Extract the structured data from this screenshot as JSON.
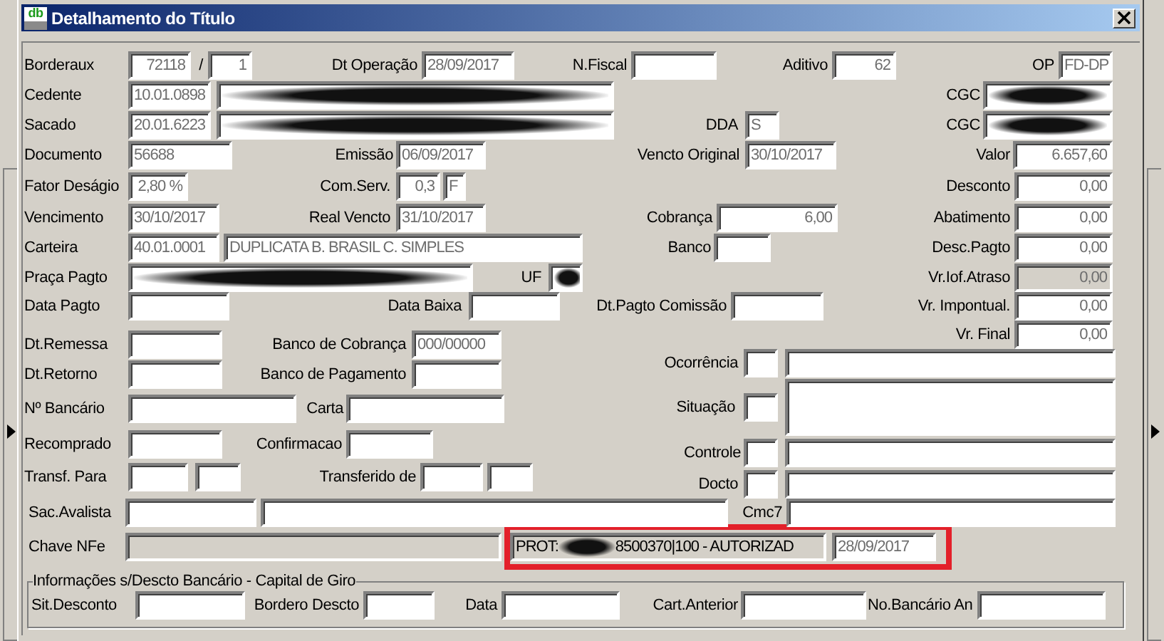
{
  "window": {
    "title": "Detalhamento do Título",
    "icon_text": "db"
  },
  "top_rows": [
    [
      {
        "kind": "label",
        "text": "Borderaux"
      },
      {
        "kind": "field",
        "value": "72118"
      },
      {
        "kind": "label",
        "text": "/"
      },
      {
        "kind": "field",
        "value": "1"
      },
      {
        "kind": "label",
        "text": "Dt Operação"
      },
      {
        "kind": "field",
        "value": "28/09/2017"
      },
      {
        "kind": "label",
        "text": "N.Fiscal"
      },
      {
        "kind": "field"
      },
      {
        "kind": "label",
        "text": "Aditivo"
      },
      {
        "kind": "field",
        "value": "62"
      },
      {
        "kind": "label",
        "text": "OP"
      },
      {
        "kind": "field",
        "value": "FD-DP"
      }
    ],
    [
      {
        "kind": "label",
        "text": "Cedente"
      },
      {
        "kind": "field",
        "value": "10.01.0898"
      },
      {
        "kind": "field",
        "redacted": true
      },
      {
        "kind": "label",
        "text": "CGC"
      },
      {
        "kind": "field",
        "redacted": true
      }
    ],
    [
      {
        "kind": "label",
        "text": "Sacado"
      },
      {
        "kind": "field",
        "value": "20.01.6223"
      },
      {
        "kind": "field",
        "redacted": true
      },
      {
        "kind": "label",
        "text": "DDA"
      },
      {
        "kind": "field",
        "value": "S"
      },
      {
        "kind": "label",
        "text": "CGC"
      },
      {
        "kind": "field",
        "redacted": true
      }
    ],
    [
      {
        "kind": "label",
        "text": "Documento"
      },
      {
        "kind": "field",
        "value": "56688"
      },
      {
        "kind": "label",
        "text": "Emissão"
      },
      {
        "kind": "field",
        "value": "06/09/2017"
      },
      {
        "kind": "label",
        "text": "Vencto Original"
      },
      {
        "kind": "field",
        "value": "30/10/2017"
      },
      {
        "kind": "label",
        "text": "Valor"
      },
      {
        "kind": "field",
        "value": "6.657,60"
      }
    ],
    [
      {
        "kind": "label",
        "text": "Fator Deságio"
      },
      {
        "kind": "field",
        "value": "2,80 %"
      },
      {
        "kind": "label",
        "text": "Com.Serv."
      },
      {
        "kind": "field",
        "value": "0,3"
      },
      {
        "kind": "field",
        "value": "F"
      },
      {
        "kind": "label",
        "text": "Desconto"
      },
      {
        "kind": "field",
        "value": "0,00"
      }
    ],
    [
      {
        "kind": "label",
        "text": "Vencimento"
      },
      {
        "kind": "field",
        "value": "30/10/2017"
      },
      {
        "kind": "label",
        "text": "Real Vencto"
      },
      {
        "kind": "field",
        "value": "31/10/2017"
      },
      {
        "kind": "label",
        "text": "Cobrança"
      },
      {
        "kind": "field",
        "value": "6,00"
      },
      {
        "kind": "label",
        "text": "Abatimento"
      },
      {
        "kind": "field",
        "value": "0,00"
      }
    ],
    [
      {
        "kind": "label",
        "text": "Carteira"
      },
      {
        "kind": "field",
        "value": "40.01.0001"
      },
      {
        "kind": "field",
        "value": "DUPLICATA B. BRASIL C. SIMPLES"
      },
      {
        "kind": "label",
        "text": "Banco"
      },
      {
        "kind": "field"
      },
      {
        "kind": "label",
        "text": "Desc.Pagto"
      },
      {
        "kind": "field",
        "value": "0,00"
      }
    ],
    [
      {
        "kind": "label",
        "text": "Praça Pagto"
      },
      {
        "kind": "field",
        "redacted": true
      },
      {
        "kind": "label",
        "text": "UF"
      },
      {
        "kind": "field",
        "redacted": true
      },
      {
        "kind": "label",
        "text": "Vr.Iof.Atraso"
      },
      {
        "kind": "field",
        "value": "0,00",
        "disabled": true
      }
    ],
    [
      {
        "kind": "label",
        "text": "Data Pagto"
      },
      {
        "kind": "field"
      },
      {
        "kind": "label",
        "text": "Data Baixa"
      },
      {
        "kind": "field"
      },
      {
        "kind": "label",
        "text": "Dt.Pagto Comissão"
      },
      {
        "kind": "field"
      },
      {
        "kind": "label",
        "text": "Vr. Impontual."
      },
      {
        "kind": "field",
        "value": "0,00"
      }
    ]
  ],
  "left_rows": [
    [
      {
        "kind": "label",
        "text": "Dt.Remessa"
      },
      {
        "kind": "field"
      },
      {
        "kind": "label",
        "text": "Banco de Cobrança"
      },
      {
        "kind": "field",
        "value": "000/00000"
      }
    ],
    [
      {
        "kind": "label",
        "text": "Dt.Retorno"
      },
      {
        "kind": "field"
      },
      {
        "kind": "label",
        "text": "Banco de Pagamento"
      },
      {
        "kind": "field"
      }
    ],
    [
      {
        "kind": "label",
        "text": "Nº Bancário"
      },
      {
        "kind": "field"
      },
      {
        "kind": "label",
        "text": "Carta"
      },
      {
        "kind": "field"
      }
    ],
    [
      {
        "kind": "label",
        "text": "Recomprado"
      },
      {
        "kind": "field"
      },
      {
        "kind": "label",
        "text": "Confirmacao"
      },
      {
        "kind": "field"
      }
    ],
    [
      {
        "kind": "label",
        "text": "Transf. Para"
      },
      {
        "kind": "field"
      },
      {
        "kind": "field"
      },
      {
        "kind": "label",
        "text": "Transferido de"
      },
      {
        "kind": "field"
      },
      {
        "kind": "field"
      }
    ]
  ],
  "right_rows": [
    [
      {
        "kind": "label",
        "text": "Vr. Final"
      },
      {
        "kind": "field",
        "value": "0,00"
      }
    ],
    [
      {
        "kind": "label",
        "text": "Ocorrência"
      },
      {
        "kind": "field"
      },
      {
        "kind": "field"
      }
    ],
    [
      {
        "kind": "label",
        "text": "Situação"
      },
      {
        "kind": "field"
      },
      {
        "kind": "memo"
      }
    ],
    [
      {
        "kind": "label",
        "text": "Controle"
      },
      {
        "kind": "field"
      },
      {
        "kind": "field"
      }
    ],
    [
      {
        "kind": "label",
        "text": "Docto"
      },
      {
        "kind": "field"
      },
      {
        "kind": "field"
      }
    ]
  ],
  "bottom_rows": [
    [
      {
        "kind": "label",
        "text": "Sac.Avalista"
      },
      {
        "kind": "field"
      },
      {
        "kind": "field"
      },
      {
        "kind": "label",
        "text": "Cmc7"
      },
      {
        "kind": "field"
      }
    ],
    [
      {
        "kind": "label",
        "text": "Chave NFe"
      },
      {
        "kind": "field",
        "disabled": true
      },
      {
        "kind": "highlight",
        "items": [
          {
            "kind": "prot",
            "value": "PROT:",
            "value_after": "8500370|100 - AUTORIZAD",
            "redacted": true
          },
          {
            "kind": "field",
            "value": "28/09/2017"
          }
        ]
      }
    ]
  ],
  "group": {
    "title": "Informações s/Descto Bancário - Capital de Giro",
    "items": [
      {
        "kind": "label",
        "text": "Sit.Desconto"
      },
      {
        "kind": "field"
      },
      {
        "kind": "label",
        "text": "Bordero Descto"
      },
      {
        "kind": "field"
      },
      {
        "kind": "label",
        "text": "Data"
      },
      {
        "kind": "field"
      },
      {
        "kind": "label",
        "text": "Cart.Anterior"
      },
      {
        "kind": "field"
      },
      {
        "kind": "label",
        "text": "No.Bancário An"
      },
      {
        "kind": "field"
      }
    ]
  }
}
